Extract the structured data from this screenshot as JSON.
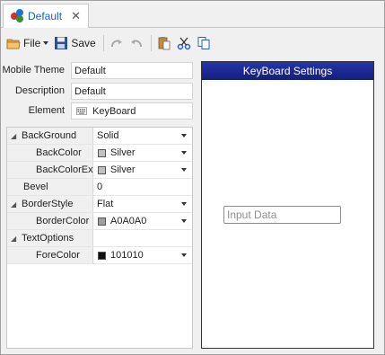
{
  "tab": {
    "label": "Default",
    "close": "✕"
  },
  "toolbar": {
    "file_label": "File",
    "save_label": "Save"
  },
  "form": {
    "mobile_theme_label": "Mobile Theme",
    "mobile_theme_value": "Default",
    "description_label": "Description",
    "description_value": "Default",
    "element_label": "Element",
    "element_value": "KeyBoard"
  },
  "properties": [
    {
      "name": "BackGround",
      "value": "Solid",
      "expanded": true,
      "dropdown": true
    },
    {
      "name": "BackColor",
      "value": "Silver",
      "swatch": "#c0c0c0",
      "dropdown": true
    },
    {
      "name": "BackColorEx",
      "value": "Silver",
      "swatch": "#c0c0c0",
      "dropdown": true
    },
    {
      "name": "Bevel",
      "value": "0"
    },
    {
      "name": "BorderStyle",
      "value": "Flat",
      "expanded": true,
      "dropdown": true
    },
    {
      "name": "BorderColor",
      "value": "A0A0A0",
      "swatch": "#a0a0a0",
      "dropdown": true
    },
    {
      "name": "TextOptions",
      "value": "",
      "expanded": true
    },
    {
      "name": "ForeColor",
      "value": "101010",
      "swatch": "#101010",
      "dropdown": true
    }
  ],
  "preview": {
    "title": "KeyBoard Settings",
    "input_placeholder": "Input Data",
    "title_color": "#1a2590"
  }
}
